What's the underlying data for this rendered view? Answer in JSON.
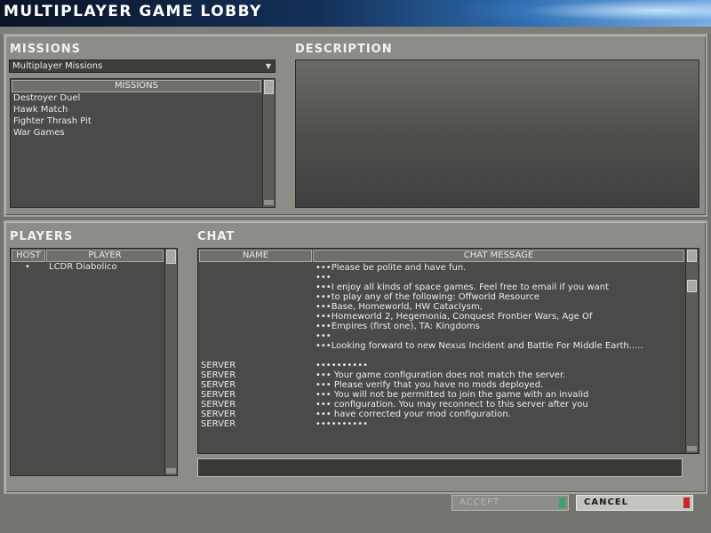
{
  "window": {
    "title": "MULTIPLAYER GAME LOBBY"
  },
  "missions": {
    "heading": "MISSIONS",
    "dropdown_value": "Multiplayer Missions",
    "list_header": "MISSIONS",
    "items": [
      "Destroyer Duel",
      "Hawk Match",
      "Fighter Thrash Pit",
      "War Games"
    ]
  },
  "description": {
    "heading": "DESCRIPTION"
  },
  "players": {
    "heading": "PLAYERS",
    "columns": [
      "HOST",
      "PLAYER"
    ],
    "rows": [
      {
        "host": "•",
        "player": "LCDR Diabolico"
      }
    ]
  },
  "chat": {
    "heading": "CHAT",
    "columns": [
      "NAME",
      "CHAT MESSAGE"
    ],
    "messages": [
      {
        "name": "",
        "text": "•••Please be polite and have fun."
      },
      {
        "name": "",
        "text": "•••"
      },
      {
        "name": "",
        "text": "•••I enjoy all kinds of space games. Feel free to email if you want"
      },
      {
        "name": "",
        "text": "•••to play any of the following:  Offworld Resource"
      },
      {
        "name": "",
        "text": "•••Base, Homeworld, HW Cataclysm,"
      },
      {
        "name": "",
        "text": "•••Homeworld 2, Hegemonia, Conquest Frontier Wars, Age Of"
      },
      {
        "name": "",
        "text": "•••Empires (first one), TA: Kingdoms"
      },
      {
        "name": "",
        "text": "•••"
      },
      {
        "name": "",
        "text": "•••Looking forward to new Nexus Incident and Battle For Middle Earth....."
      },
      {
        "name": "",
        "text": ""
      },
      {
        "name": "SERVER",
        "text": "••••••••••"
      },
      {
        "name": "SERVER",
        "text": "•••  Your game configuration does not match the server."
      },
      {
        "name": "SERVER",
        "text": "•••  Please verify that you have no mods deployed."
      },
      {
        "name": "SERVER",
        "text": "•••  You will not be permitted to join the game with an invalid"
      },
      {
        "name": "SERVER",
        "text": "•••  configuration.  You may reconnect to this server after you"
      },
      {
        "name": "SERVER",
        "text": "•••  have corrected your mod configuration."
      },
      {
        "name": "SERVER",
        "text": "••••••••••"
      }
    ],
    "input_value": ""
  },
  "buttons": {
    "accept": "ACCEPT",
    "cancel": "CANCEL"
  },
  "colors": {
    "accept_cap": "#3fa06a",
    "cancel_cap": "#c42828"
  }
}
